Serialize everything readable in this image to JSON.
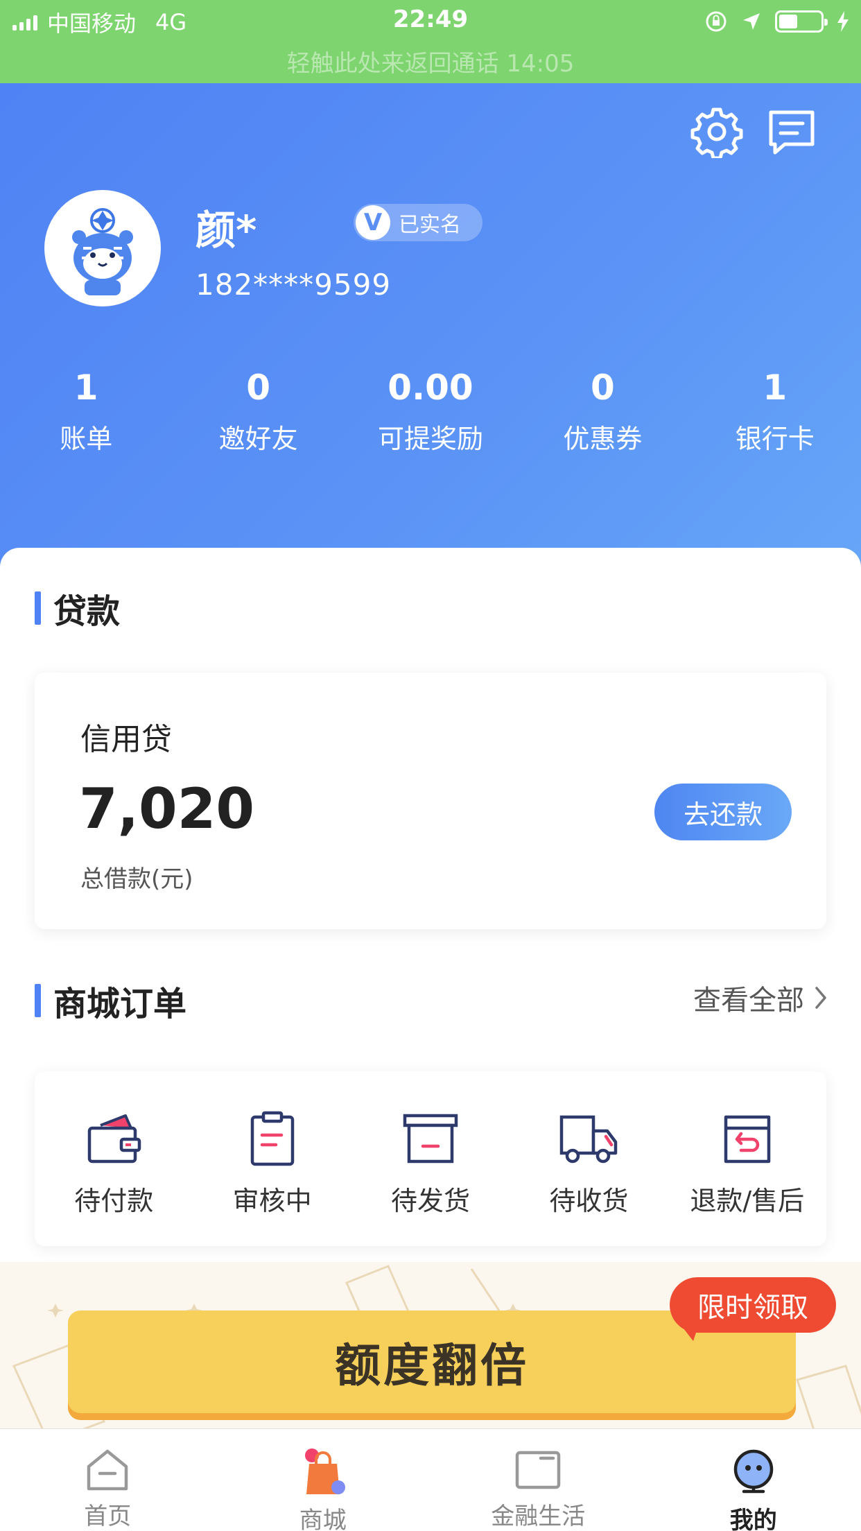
{
  "status_bar": {
    "carrier": "中国移动",
    "network": "4G",
    "time": "22:49",
    "call_banner": "轻触此处来返回通话 14:05",
    "battery_level": 0.45
  },
  "profile": {
    "name": "颜*",
    "verified_badge": "V",
    "verified_label": "已实名",
    "phone": "182****9599"
  },
  "stats": [
    {
      "value": "1",
      "label": "账单"
    },
    {
      "value": "0",
      "label": "邀好友"
    },
    {
      "value": "0.00",
      "label": "可提奖励"
    },
    {
      "value": "0",
      "label": "优惠券"
    },
    {
      "value": "1",
      "label": "银行卡"
    }
  ],
  "loan_section": {
    "title": "贷款",
    "card_title": "信用贷",
    "amount": "7,020",
    "amount_caption": "总借款(元)",
    "repay_button": "去还款"
  },
  "orders_section": {
    "title": "商城订单",
    "view_all": "查看全部",
    "items": [
      {
        "label": "待付款",
        "icon": "wallet-icon"
      },
      {
        "label": "审核中",
        "icon": "clipboard-icon"
      },
      {
        "label": "待发货",
        "icon": "box-icon"
      },
      {
        "label": "待收货",
        "icon": "truck-icon"
      },
      {
        "label": "退款/售后",
        "icon": "return-box-icon"
      }
    ]
  },
  "promo": {
    "button": "额度翻倍",
    "tag": "限时领取"
  },
  "tabs": [
    {
      "label": "首页",
      "icon": "home-icon"
    },
    {
      "label": "商城",
      "icon": "shopping-bag-icon"
    },
    {
      "label": "金融生活",
      "icon": "card-icon"
    },
    {
      "label": "我的",
      "icon": "profile-icon",
      "active": true
    }
  ],
  "colors": {
    "status_bar": "#7ed46f",
    "header_gradient_start": "#4f82f4",
    "header_gradient_end": "#66a6f8",
    "accent": "#4f82f4",
    "promo_yellow": "#f7cf5b",
    "promo_tag_red": "#ef4b33",
    "icon_navy": "#2d3a6b",
    "icon_pink": "#f0426b"
  }
}
